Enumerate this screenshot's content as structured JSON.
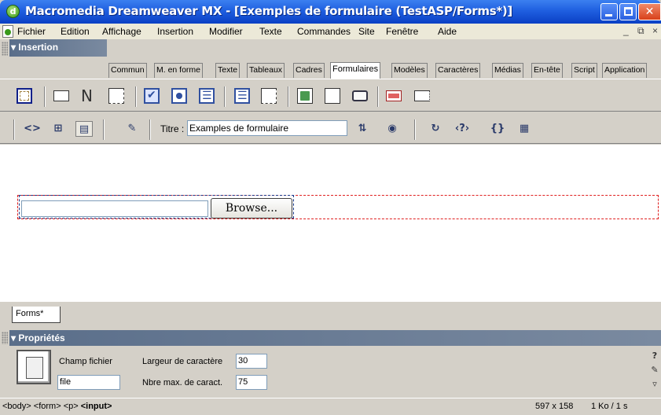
{
  "window": {
    "title": "Macromedia Dreamweaver MX - [Exemples de formulaire (TestASP/Forms*)]",
    "app_icon": "dreamweaver-icon",
    "controls": [
      "minimize",
      "maximize",
      "close"
    ]
  },
  "menubar": {
    "items": [
      "Fichier",
      "Edition",
      "Affichage",
      "Insertion",
      "Modifier",
      "Texte",
      "Commandes",
      "Site",
      "Fenêtre",
      "Aide"
    ],
    "mdi_minimize": "_",
    "mdi_restore": "⧉",
    "mdi_close": "×"
  },
  "insert_panel": {
    "title": "▾ Insertion",
    "tabs": [
      "Commun",
      "M. en forme",
      "Texte",
      "Tableaux",
      "Cadres",
      "Formulaires",
      "Modèles",
      "Caractères",
      "Médias",
      "En-tête",
      "Script",
      "Application"
    ],
    "active_tab": "Formulaires",
    "icons": [
      "form-icon",
      "text-field-icon",
      "hidden-field-icon",
      "textarea-icon",
      "checkbox-icon",
      "radio-button-icon",
      "list-menu-icon",
      "radio-group-icon",
      "image-field-icon",
      "file-field-icon",
      "button-icon",
      "label-icon",
      "fieldset-icon"
    ]
  },
  "doc_toolbar": {
    "icons": [
      "code-view-icon",
      "split-view-icon",
      "design-view-icon",
      "validate-icon",
      "file-management-icon",
      "preview-icon",
      "refresh-icon",
      "reference-icon",
      "code-navigation-icon",
      "view-options-icon"
    ],
    "title_label": "Titre :",
    "title_value": "Examples de formulaire"
  },
  "document": {
    "browse_label": "Browse..."
  },
  "doc_tab": {
    "label": "Forms*"
  },
  "properties": {
    "title": "▾ Propriétés",
    "type_label": "Champ fichier",
    "name_value": "file",
    "char_width_label": "Largeur de caractère",
    "char_width_value": "30",
    "max_chars_label": "Nbre max. de caract.",
    "max_chars_value": "75"
  },
  "statusbar": {
    "tags": [
      "<body>",
      "<form>",
      "<p>"
    ],
    "selected_tag": "<input>",
    "window_size": "597 x 158",
    "download": "1 Ko / 1 s"
  },
  "colors": {
    "titlebar": "#1f5fe0",
    "panel_header": "#6a7c94",
    "form_outline": "#e02020",
    "selection_outline": "#1a3a8a"
  }
}
